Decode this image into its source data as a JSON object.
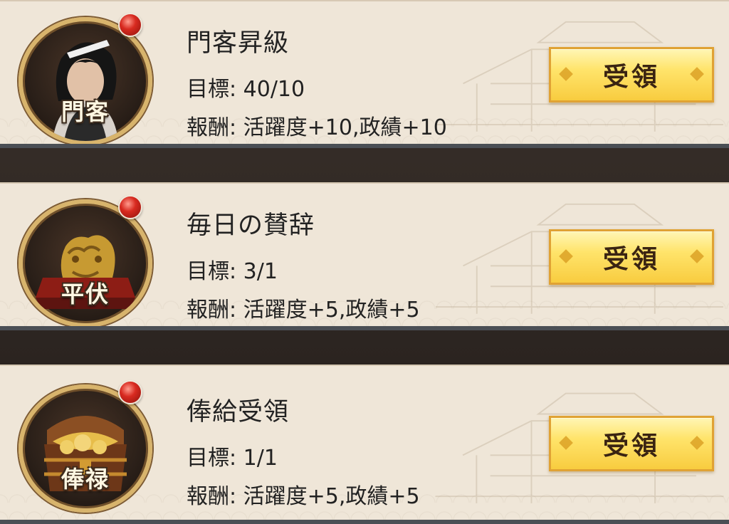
{
  "quests": [
    {
      "icon_name": "retainer-portrait-icon",
      "icon_label": "門客",
      "title": "門客昇級",
      "goal": "目標: 40/10",
      "reward": "報酬: 活躍度+10,政績+10",
      "button": "受領"
    },
    {
      "icon_name": "golden-dragon-seal-icon",
      "icon_label": "平伏",
      "title": "毎日の賛辞",
      "goal": "目標: 3/1",
      "reward": "報酬: 活躍度+5,政績+5",
      "button": "受領"
    },
    {
      "icon_name": "treasure-chest-icon",
      "icon_label": "俸禄",
      "title": "俸給受領",
      "goal": "目標: 1/1",
      "reward": "報酬: 活躍度+5,政績+5",
      "button": "受領"
    }
  ],
  "colors": {
    "card_bg": "#efe6d8",
    "button_gold": "#ffe46b",
    "notification_red": "#d82a20",
    "icon_ring": "#d8b46c"
  }
}
